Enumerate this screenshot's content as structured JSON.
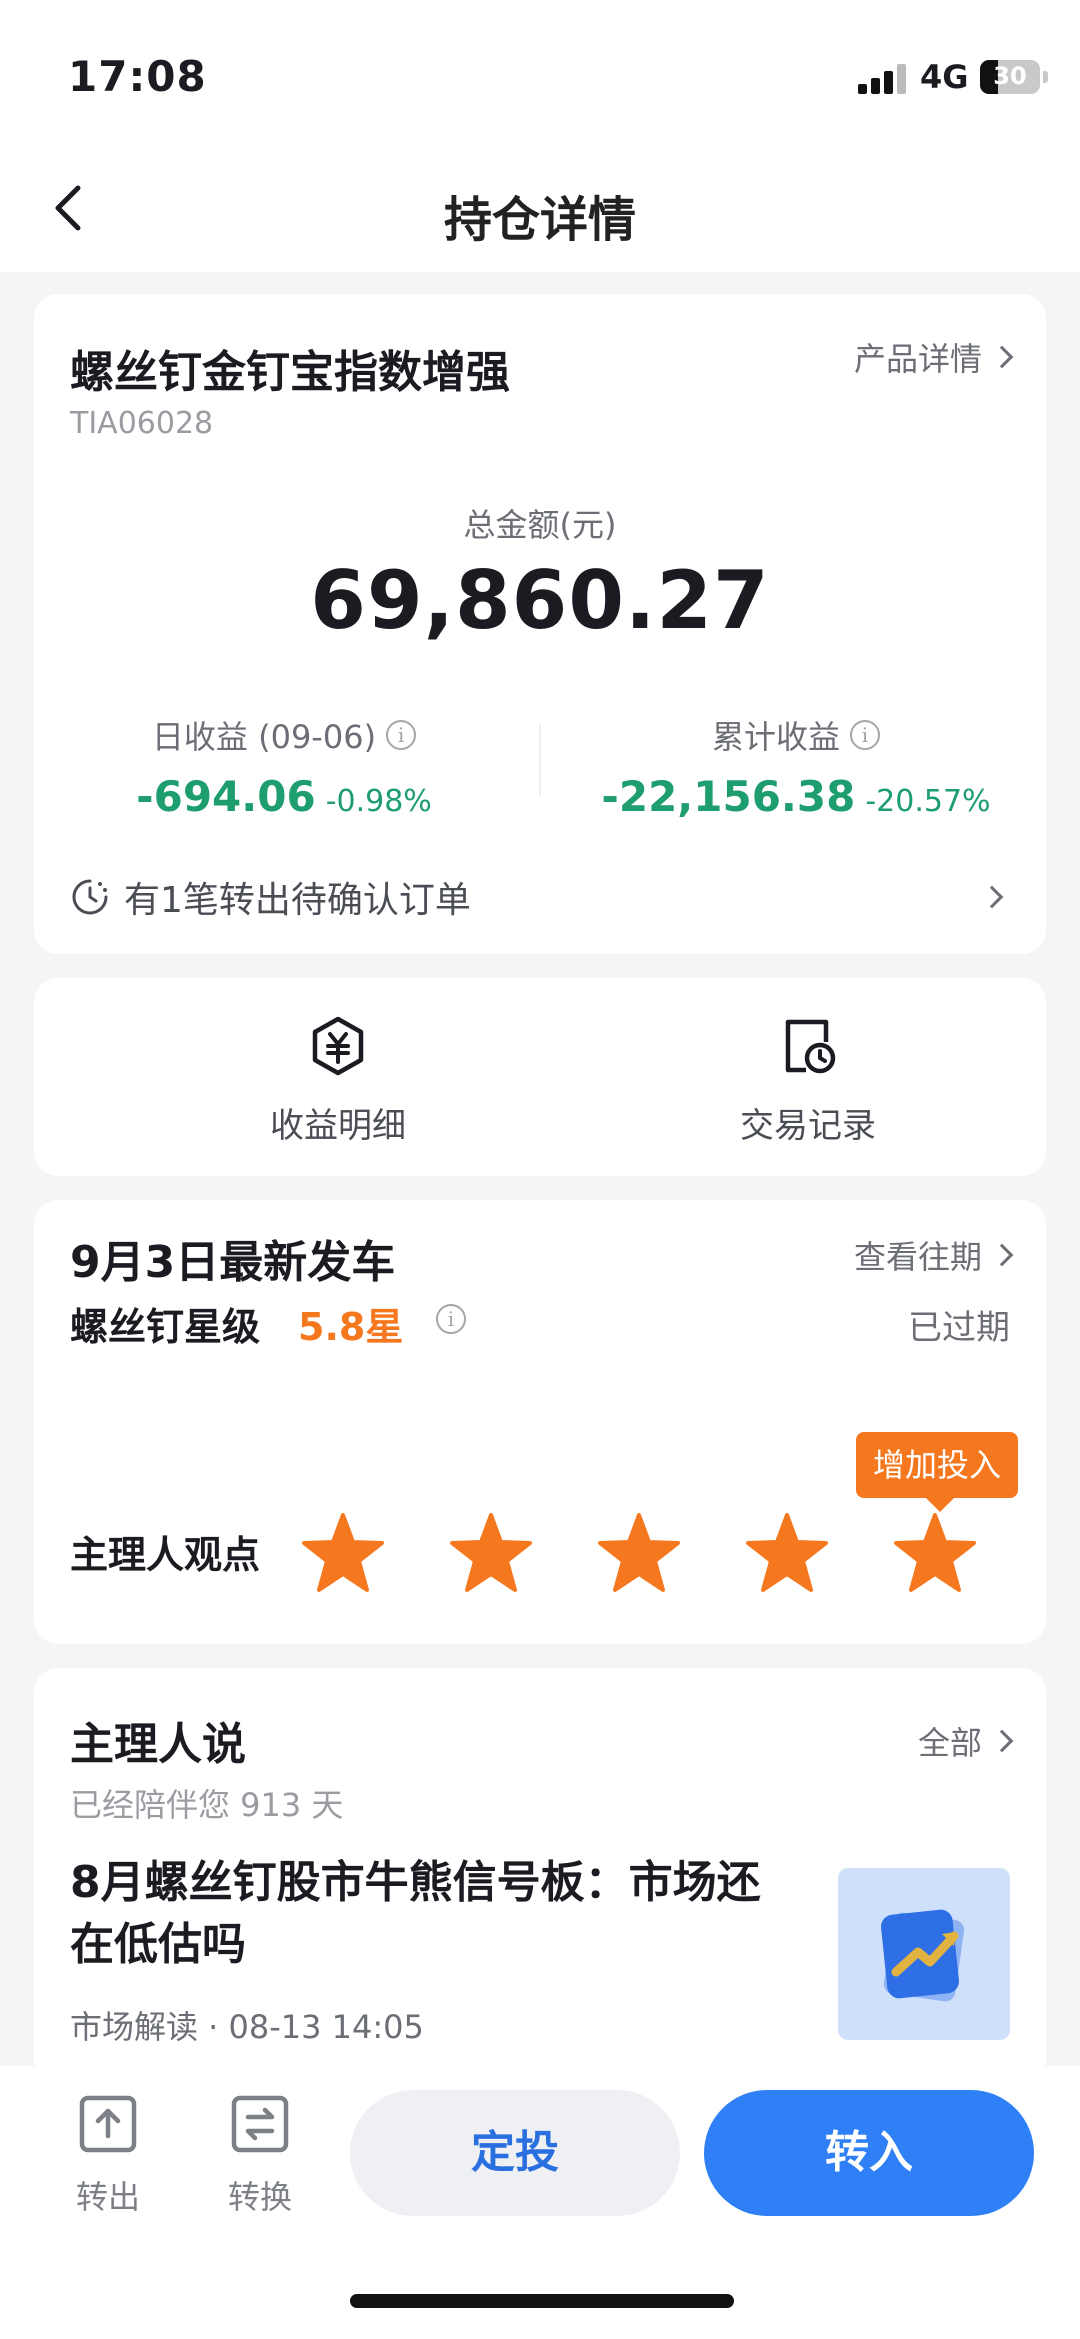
{
  "status_bar": {
    "time": "17:08",
    "network": "4G",
    "battery": "30",
    "battery_level": 0.3
  },
  "nav": {
    "title": "持仓详情"
  },
  "holding": {
    "product_name": "螺丝钉金钉宝指数增强",
    "product_code": "TIA06028",
    "detail_link": "产品详情",
    "total_label": "总金额(元)",
    "total_value": "69,860.27",
    "daily": {
      "label": "日收益 (09-06)",
      "value": "-694.06",
      "pct": "-0.98%"
    },
    "cumulative": {
      "label": "累计收益",
      "value": "-22,156.38",
      "pct": "-20.57%"
    },
    "pending_order": "有1笔转出待确认订单"
  },
  "actions": [
    {
      "label": "收益明细",
      "icon": "yuan-hexagon-icon"
    },
    {
      "label": "交易记录",
      "icon": "record-clock-icon"
    }
  ],
  "departure": {
    "title": "9月3日最新发车",
    "history_link": "查看往期",
    "rating_label": "螺丝钉星级",
    "rating_value": "5.8星",
    "status": "已过期",
    "viewpoint_label": "主理人观点",
    "tooltip": "增加投入",
    "stars": 5
  },
  "manager": {
    "title": "主理人说",
    "all_link": "全部",
    "accompany": "已经陪伴您 913 天",
    "article_title": "8月螺丝钉股市牛熊信号板：市场还在低估吗",
    "article_meta": "市场解读 · 08-13 14:05"
  },
  "bottom": {
    "transfer_out": "转出",
    "switch": "转换",
    "auto_invest": "定投",
    "transfer_in": "转入"
  },
  "colors": {
    "loss": "#1e9e6e",
    "accent": "#f5781f",
    "primary": "#2f80f7"
  }
}
